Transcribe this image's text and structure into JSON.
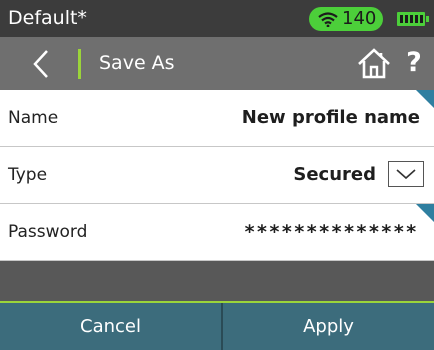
{
  "status_bar": {
    "profile_title": "Default*",
    "signal_value": "140",
    "icons": {
      "wifi": "wifi-icon",
      "battery": "battery-icon"
    },
    "colors": {
      "badge": "#4ccf3a"
    }
  },
  "nav_bar": {
    "title": "Save As",
    "icons": {
      "back": "chevron-left-icon",
      "home": "home-icon"
    },
    "help_label": "?"
  },
  "rows": {
    "name": {
      "label": "Name",
      "value": "New profile name"
    },
    "type": {
      "label": "Type",
      "value": "Secured",
      "dropdown_icon": "chevron-down-icon"
    },
    "password": {
      "label": "Password",
      "value": "**************"
    }
  },
  "footer": {
    "cancel_label": "Cancel",
    "apply_label": "Apply",
    "colors": {
      "bar": "#3c6c7c",
      "accent": "#9bd43a",
      "corner": "#2f7fa0"
    }
  }
}
